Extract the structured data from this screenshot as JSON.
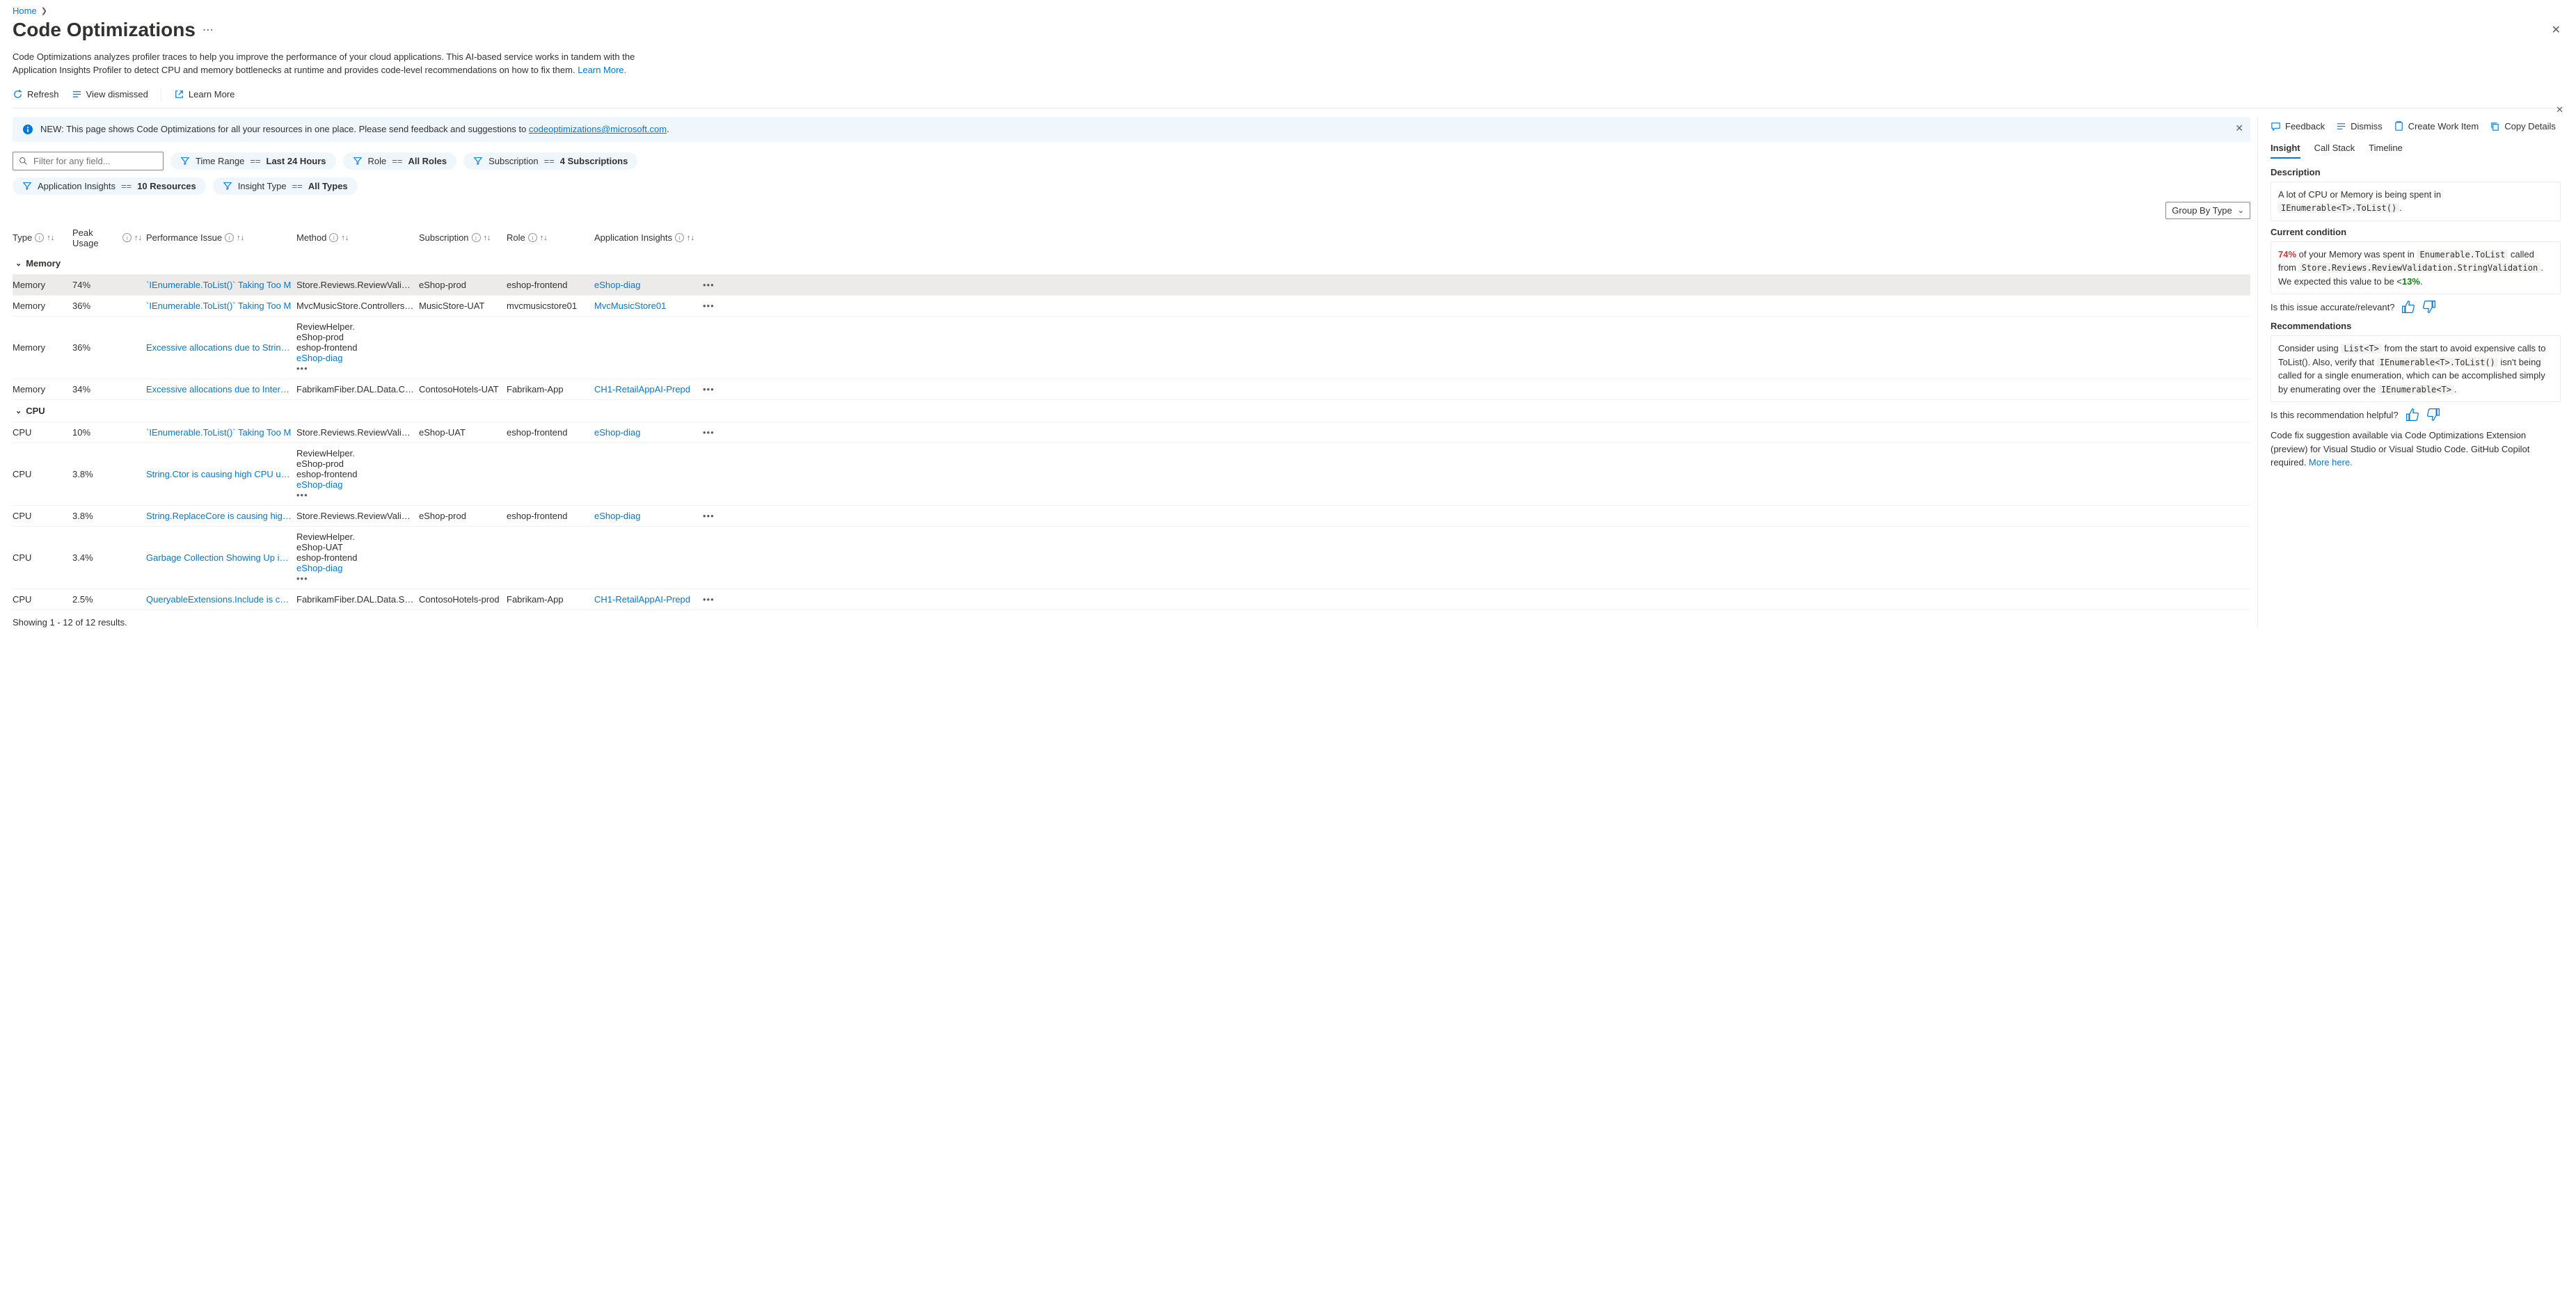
{
  "breadcrumb": {
    "home": "Home"
  },
  "page": {
    "title": "Code Optimizations",
    "description_1": "Code Optimizations analyzes profiler traces to help you improve the performance of your cloud applications. This AI-based service works in tandem with the Application Insights Profiler to detect CPU and memory bottlenecks at runtime and provides code-level recommendations on how to fix them. ",
    "learn_more": "Learn More."
  },
  "toolbar": {
    "refresh": "Refresh",
    "view_dismissed": "View dismissed",
    "learn_more": "Learn More"
  },
  "info_bar": {
    "prefix": "NEW: This page shows Code Optimizations for all your resources in one place. Please send feedback and suggestions to ",
    "email": "codeoptimizations@microsoft.com",
    "suffix": "."
  },
  "filters": {
    "placeholder": "Filter for any field...",
    "time_label": "Time Range",
    "time_value": "Last 24 Hours",
    "role_label": "Role",
    "role_value": "All Roles",
    "sub_label": "Subscription",
    "sub_value": "4 Subscriptions",
    "ai_label": "Application Insights",
    "ai_value": "10 Resources",
    "type_label": "Insight Type",
    "type_value": "All Types",
    "op": "=="
  },
  "groupby": {
    "label": "Group By Type"
  },
  "columns": {
    "type": "Type",
    "peak": "Peak Usage",
    "issue": "Performance Issue",
    "method": "Method",
    "subscription": "Subscription",
    "role": "Role",
    "appinsights": "Application Insights"
  },
  "groups": {
    "memory": "Memory",
    "cpu": "CPU"
  },
  "rows_memory": [
    {
      "type": "Memory",
      "peak": "74%",
      "issue": "`IEnumerable<T>.ToList()` Taking Too M",
      "method": "Store.Reviews.ReviewValidatio",
      "sub": "eShop-prod",
      "role": "eshop-frontend",
      "ai": "eShop-diag"
    },
    {
      "type": "Memory",
      "peak": "36%",
      "issue": "`IEnumerable<T>.ToList()` Taking Too M",
      "method": "MvcMusicStore.Controllers.Stc",
      "sub": "MusicStore-UAT",
      "role": "mvcmusicstore01",
      "ai": "MvcMusicStore01"
    },
    {
      "type": "Memory",
      "peak": "36%",
      "issue": "Excessive allocations due to String.Ctor",
      "method": "ReviewHelper.<LoadDisallowe",
      "sub": "eShop-prod",
      "role": "eshop-frontend",
      "ai": "eShop-diag"
    },
    {
      "type": "Memory",
      "peak": "34%",
      "issue": "Excessive allocations due to InternalSet",
      "method": "FabrikamFiber.DAL.Data.Custc",
      "sub": "ContosoHotels-UAT",
      "role": "Fabrikam-App",
      "ai": "CH1-RetailAppAI-Prepd"
    }
  ],
  "rows_cpu": [
    {
      "type": "CPU",
      "peak": "10%",
      "issue": "`IEnumerable<T>.ToList()` Taking Too M",
      "method": "Store.Reviews.ReviewValidatio",
      "sub": "eShop-UAT",
      "role": "eshop-frontend",
      "ai": "eShop-diag"
    },
    {
      "type": "CPU",
      "peak": "3.8%",
      "issue": "String.Ctor is causing high CPU usage",
      "method": "ReviewHelper.<LoadDisallowe",
      "sub": "eShop-prod",
      "role": "eshop-frontend",
      "ai": "eShop-diag"
    },
    {
      "type": "CPU",
      "peak": "3.8%",
      "issue": "String.ReplaceCore is causing high CPU",
      "method": "Store.Reviews.ReviewValidatio",
      "sub": "eShop-prod",
      "role": "eshop-frontend",
      "ai": "eShop-diag"
    },
    {
      "type": "CPU",
      "peak": "3.4%",
      "issue": "Garbage Collection Showing Up in CPU",
      "method": "ReviewHelper.<LoadDisallowe",
      "sub": "eShop-UAT",
      "role": "eshop-frontend",
      "ai": "eShop-diag"
    },
    {
      "type": "CPU",
      "peak": "2.5%",
      "issue": "QueryableExtensions.Include is causing",
      "method": "FabrikamFiber.DAL.Data.Servic",
      "sub": "ContosoHotels-prod",
      "role": "Fabrikam-App",
      "ai": "CH1-RetailAppAI-Prepd"
    }
  ],
  "results_footer": "Showing 1 - 12 of 12 results.",
  "panel": {
    "feedback": "Feedback",
    "dismiss": "Dismiss",
    "create_work_item": "Create Work Item",
    "copy_details": "Copy Details",
    "tabs": {
      "insight": "Insight",
      "callstack": "Call Stack",
      "timeline": "Timeline"
    },
    "desc_label": "Description",
    "desc_text": "A lot of CPU or Memory is being spent in",
    "desc_code": "IEnumerable<T>.ToList()",
    "cond_label": "Current condition",
    "cond_pct": "74%",
    "cond_text1": " of your Memory was spent in ",
    "cond_code1": "Enumerable.ToList",
    "cond_text2": " called from ",
    "cond_code2": "Store.Reviews.ReviewValidation.StringValidation",
    "cond_text3": ". We expected this value to be <",
    "cond_pct_exp": "13%",
    "cond_text4": ".",
    "accuracy_q": "Is this issue accurate/relevant?",
    "rec_label": "Recommendations",
    "rec_t1": "Consider using ",
    "rec_c1": "List<T>",
    "rec_t2": " from the start to avoid expensive calls to ToList(). Also, verify that ",
    "rec_c2": "IEnumerable<T>.ToList()",
    "rec_t3": " isn't being called for a single enumeration, which can be accomplished simply by enumerating over the ",
    "rec_c3": "IEnumerable<T>",
    "rec_t4": ".",
    "helpful_q": "Is this recommendation helpful?",
    "codefix_text": "Code fix suggestion available via Code Optimizations Extension (preview) for Visual Studio or Visual Studio Code. GitHub Copilot required. ",
    "codefix_link": "More here."
  }
}
